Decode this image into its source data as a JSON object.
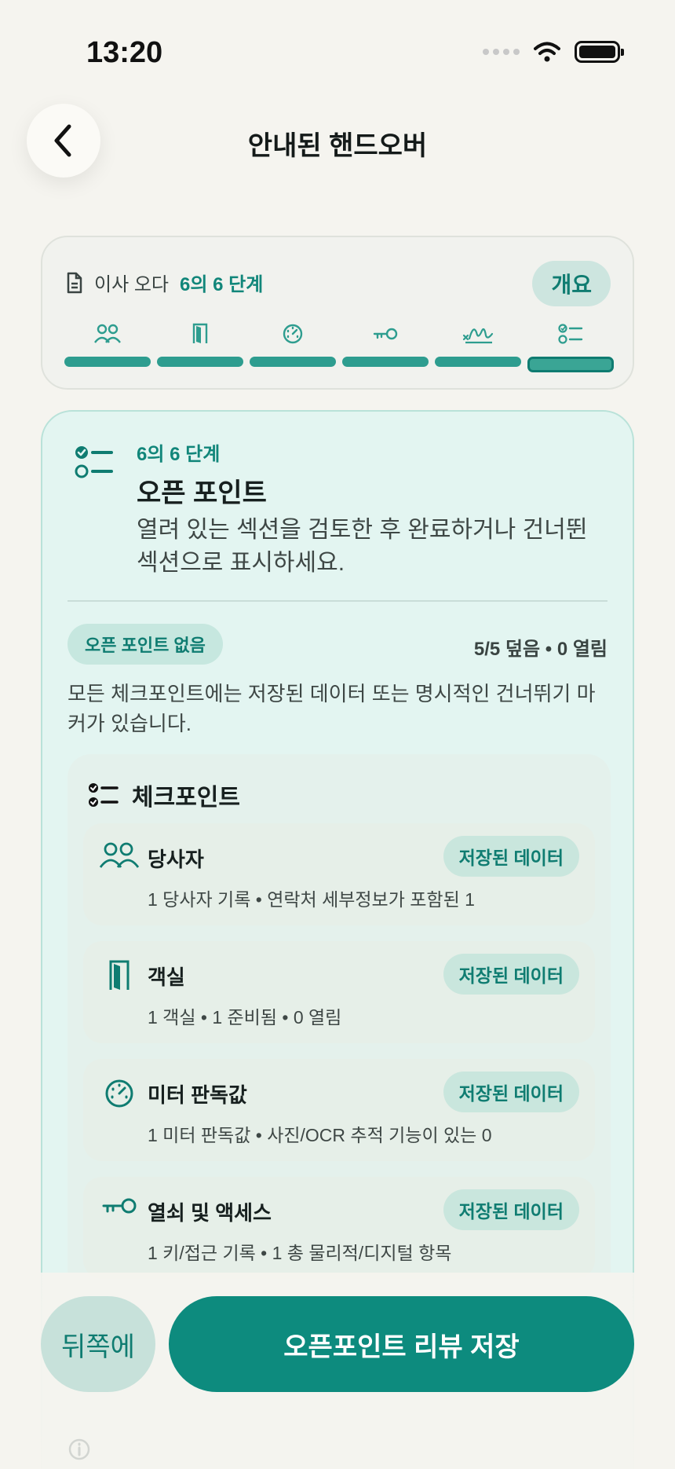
{
  "status_bar": {
    "time": "13:20",
    "icons": [
      "signal-icon",
      "wifi-icon",
      "battery-icon"
    ]
  },
  "header": {
    "title": "안내된 핸드오버",
    "back_icon": "chevron-left-icon"
  },
  "progress": {
    "label": "이사 오다",
    "step_text": "6의 6 단계",
    "overview_label": "개요",
    "steps": [
      {
        "icon": "people-icon",
        "state": "complete"
      },
      {
        "icon": "door-icon",
        "state": "complete"
      },
      {
        "icon": "meter-icon",
        "state": "complete"
      },
      {
        "icon": "key-icon",
        "state": "complete"
      },
      {
        "icon": "signature-icon",
        "state": "complete"
      },
      {
        "icon": "checklist-icon",
        "state": "active"
      }
    ]
  },
  "intro": {
    "step_text": "6의 6 단계",
    "title": "오픈 포인트",
    "description": "열려 있는 섹션을 검토한 후 완료하거나 건너뛴 섹션으로 표시하세요."
  },
  "summary": {
    "badge": "오픈 포인트 없음",
    "coverage": "5/5 덮음 • 0 열림",
    "note": "모든 체크포인트에는 저장된 데이터 또는 명시적인 건너뛰기 마커가 있습니다."
  },
  "checkpoints": {
    "title": "체크포인트",
    "items": [
      {
        "icon": "people-icon",
        "name": "당사자",
        "badge": "저장된 데이터",
        "detail": "1 당사자 기록 • 연락처 세부정보가 포함된 1"
      },
      {
        "icon": "door-icon",
        "name": "객실",
        "badge": "저장된 데이터",
        "detail": "1 객실 • 1 준비됨 • 0 열림"
      },
      {
        "icon": "meter-icon",
        "name": "미터 판독값",
        "badge": "저장된 데이터",
        "detail": "1 미터 판독값 • 사진/OCR 추적 기능이 있는 0"
      },
      {
        "icon": "key-icon",
        "name": "열쇠 및 액세스",
        "badge": "저장된 데이터",
        "detail": "1 키/접근 기록 • 1 총 물리적/디지털 항목"
      }
    ]
  },
  "footer": {
    "back_label": "뒤쪽에",
    "save_label": "오픈포인트 리뷰 저장"
  },
  "colors": {
    "accent": "#0d8b7e",
    "card_bg": "#e3f5f1",
    "page_bg": "#f5f4ef"
  }
}
